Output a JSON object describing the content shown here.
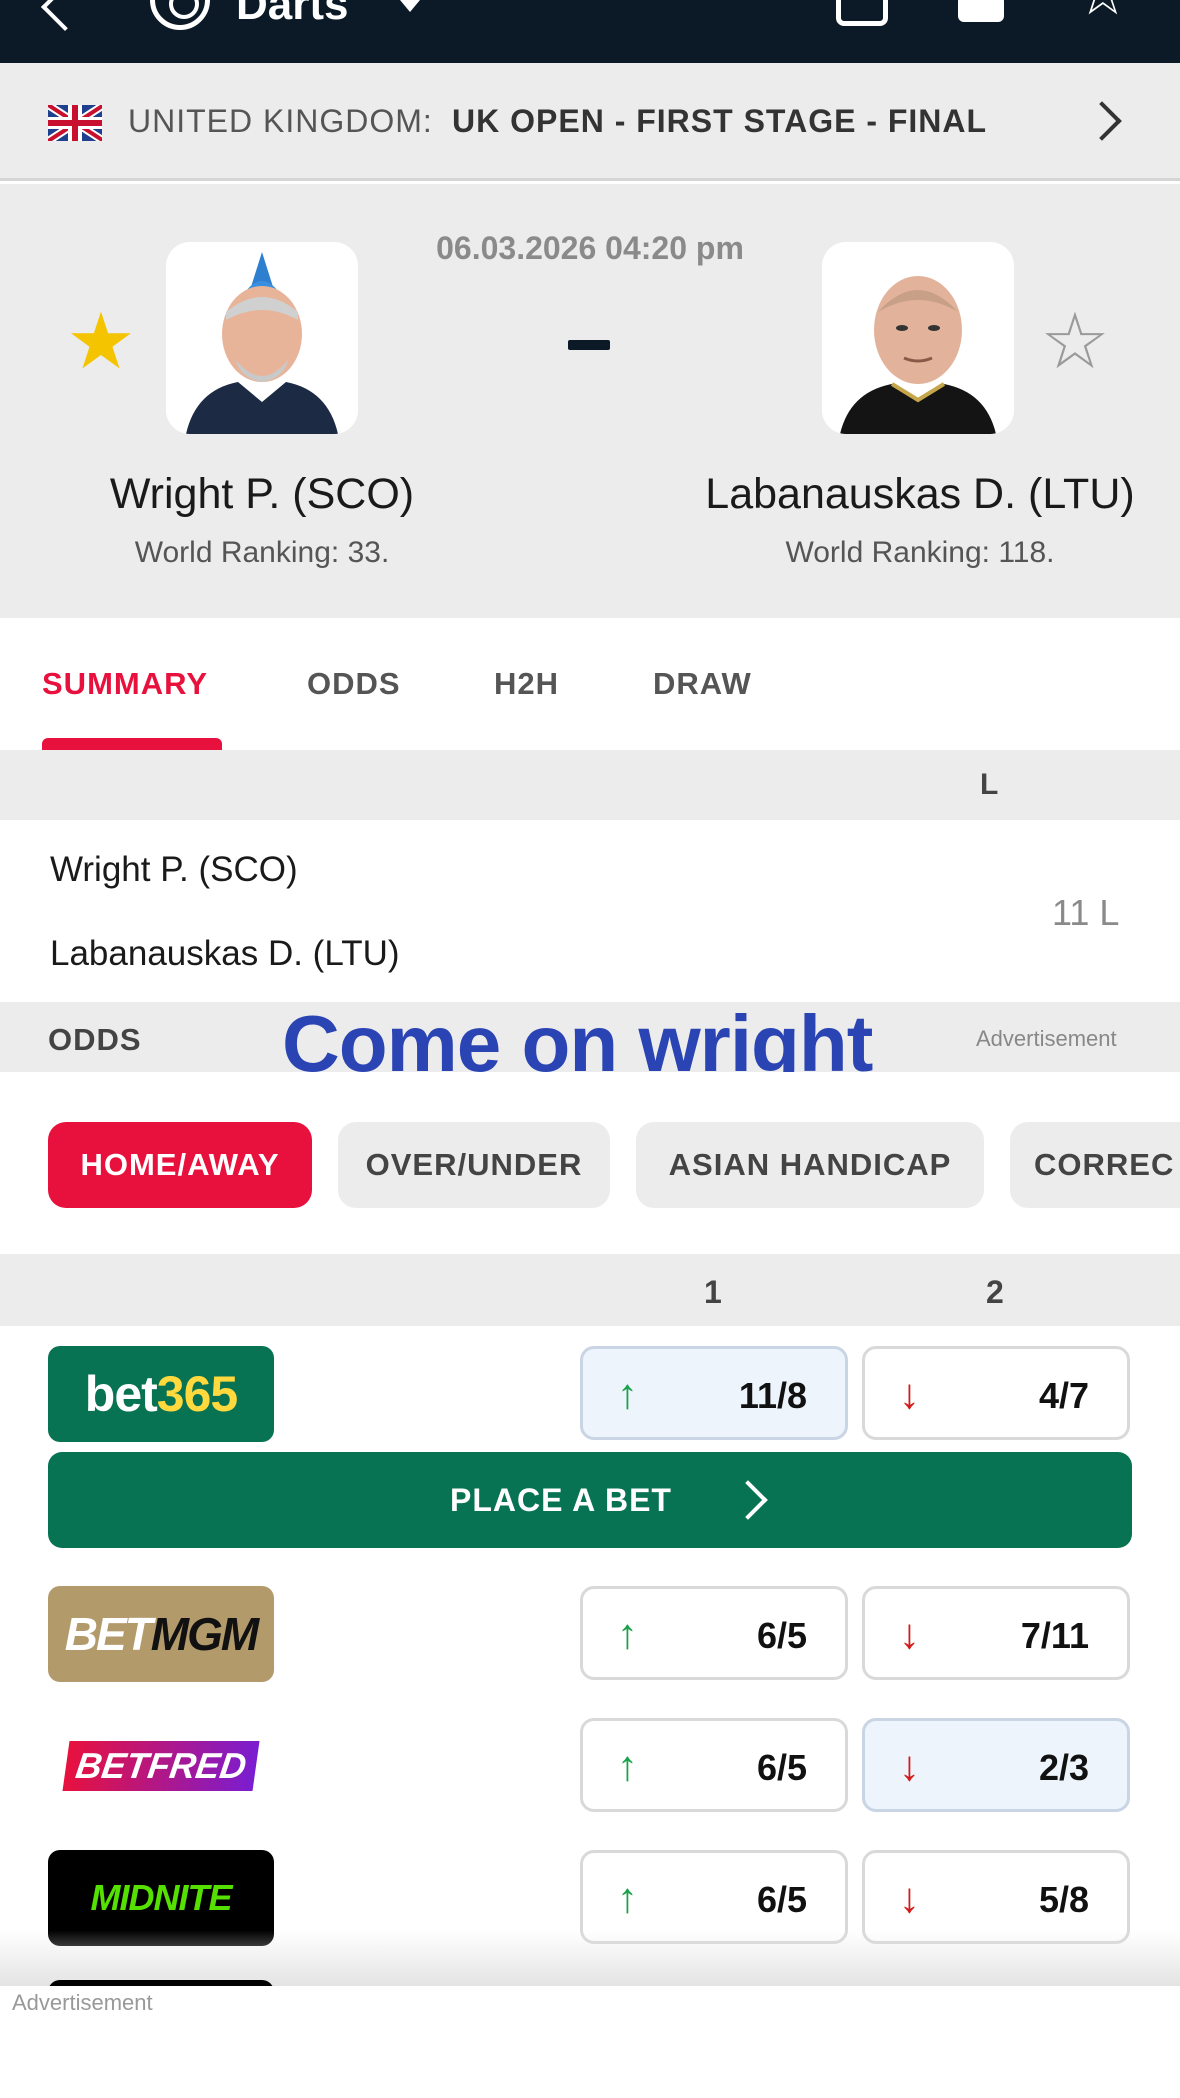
{
  "header": {
    "title": "Darts",
    "back_icon": "back-arrow-icon",
    "sport_icon": "dartboard-icon",
    "share_icon": "share-icon",
    "bell_icon": "bell-icon",
    "star_icon": "star-icon"
  },
  "tournament": {
    "country": "UNITED KINGDOM:",
    "stage": "UK OPEN - FIRST STAGE - FINAL"
  },
  "match": {
    "datetime": "06.03.2026 04:20 pm",
    "score": "-",
    "home": {
      "name": "Wright P. (SCO)",
      "ranking": "World Ranking: 33.",
      "favorite": true
    },
    "away": {
      "name": "Labanauskas D. (LTU)",
      "ranking": "World Ranking: 118.",
      "favorite": false
    }
  },
  "tabs": [
    {
      "label": "SUMMARY",
      "active": true
    },
    {
      "label": "ODDS",
      "active": false
    },
    {
      "label": "H2H",
      "active": false
    },
    {
      "label": "DRAW",
      "active": false
    }
  ],
  "summary": {
    "column": "L",
    "rows": [
      "Wright P. (SCO)",
      "Labanauskas D. (LTU)"
    ],
    "result": "11 L"
  },
  "odds": {
    "section_label": "ODDS",
    "advertisement": "Advertisement",
    "overlay_text": "Come on wright",
    "markets": [
      "HOME/AWAY",
      "OVER/UNDER",
      "ASIAN HANDICAP",
      "CORREC"
    ],
    "col1": "1",
    "col2": "2",
    "place_bet": "PLACE A BET",
    "bookmakers": [
      {
        "name": "bet365",
        "home": "11/8",
        "away": "4/7",
        "home_trend": "up",
        "away_trend": "down"
      },
      {
        "name": "BETMGM",
        "home": "6/5",
        "away": "7/11",
        "home_trend": "up",
        "away_trend": "down"
      },
      {
        "name": "BETFRED",
        "home": "6/5",
        "away": "2/3",
        "home_trend": "up",
        "away_trend": "down"
      },
      {
        "name": "MIDNITE",
        "home": "6/5",
        "away": "5/8",
        "home_trend": "up",
        "away_trend": "down"
      }
    ]
  },
  "footer": {
    "advertisement": "Advertisement"
  },
  "colors": {
    "accent": "#e8113d",
    "header_bg": "#0b1a26",
    "bet365": "#087353",
    "up": "#19a34a",
    "down": "#d21a1a"
  }
}
